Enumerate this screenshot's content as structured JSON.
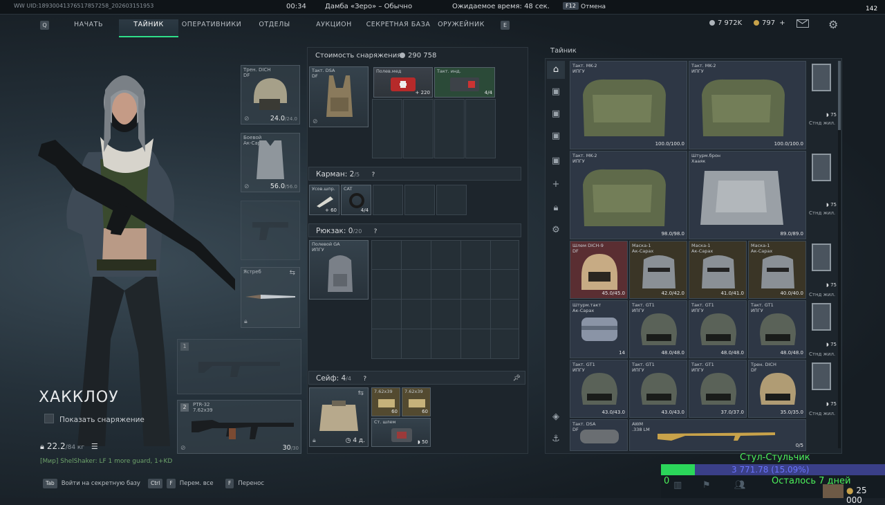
{
  "topbar": {
    "uid": "WW UID:18930041376517857258_202603151953",
    "time": "00:34",
    "map": "Дамба «Зеро» – Обычно",
    "wait": "Ожидаемое время: 48 сек.",
    "cancel_key": "F12",
    "cancel": "Отмена",
    "fps": "142"
  },
  "nav": {
    "left_key": "Q",
    "right_key": "E",
    "tabs": [
      "НАЧАТЬ",
      "ТАЙНИК",
      "ОПЕРАТИВНИКИ",
      "ОТДЕЛЫ",
      "АУКЦИОН",
      "СЕКРЕТНАЯ БАЗА",
      "ОРУЖЕЙНИК"
    ],
    "active": 1
  },
  "currency": {
    "silver": "7 972K",
    "gold": "797"
  },
  "character": {
    "name": "ХАККЛОУ",
    "show_gear": "Показать снаряжение",
    "weight": "22.2",
    "weight_max": "/84 кг",
    "chat": "[Мир] ShelShaker: LF 1 more guard, 1+KD"
  },
  "equip": {
    "helmet": {
      "label1": "Трен. DICH",
      "label2": "DF",
      "dur": "24.0",
      "max": "/24.0"
    },
    "armor": {
      "label1": "Боевой",
      "label2": "Ак-Сарах",
      "dur": "56.0",
      "max": "/56.0"
    },
    "melee": {
      "label1": "Ястреб"
    },
    "slot1_num": "1",
    "slot2_num": "2",
    "weapon2": {
      "label1": "PTR-32",
      "label2": "7.62x39",
      "ammo": "30",
      "ammo_max": "/30"
    }
  },
  "gear": {
    "cost_label": "Стоимость снаряжения",
    "cost": "290 758",
    "vest": {
      "label1": "Такт. DSA",
      "label2": "DF"
    },
    "items_top": [
      {
        "label": "Полев.мед",
        "cnt": "220"
      },
      {
        "label": "Такт. инд.",
        "cnt": "4/4"
      }
    ],
    "pocket_label": "Карман:",
    "pocket_val": "2",
    "pocket_max": "/5",
    "pocket_items": [
      {
        "label": "Усов.шпр.",
        "cnt": "60"
      },
      {
        "label": "CAT",
        "cnt": "4/4"
      }
    ],
    "backpack_label": "Рюкзак:",
    "backpack_val": "0",
    "backpack_max": "/20",
    "backpack": {
      "label1": "Полевой GA",
      "label2": "ИПГУ"
    },
    "safe_label": "Сейф:",
    "safe_val": "4",
    "safe_max": "/4",
    "safe_time": "4 д.",
    "safe_items": [
      {
        "label": "7.62x39",
        "cnt": "60"
      },
      {
        "label": "7.62x39",
        "cnt": "60"
      },
      {
        "label": "Ст. шлем",
        "cnt": "50"
      }
    ],
    "help": "?"
  },
  "stash": {
    "title": "Тайник",
    "items": [
      {
        "l1": "Такт. MK-2",
        "l2": "ИПГУ",
        "dur": "100.0/100.0"
      },
      {
        "l1": "Такт. MK-2",
        "l2": "ИПГУ",
        "dur": "100.0/100.0"
      },
      {
        "l1": "Такт. MK-2",
        "l2": "ИПГУ",
        "dur": "98.0/98.0"
      },
      {
        "l1": "Штурм.брон",
        "l2": "Хааяк",
        "dur": "89.0/89.0"
      },
      {
        "l1": "Шлем DICH-9",
        "l2": "DF",
        "dur": "45.0/45.0"
      },
      {
        "l1": "Маска-1",
        "l2": "Ак-Сарах",
        "dur": "42.0/42.0"
      },
      {
        "l1": "Маска-1",
        "l2": "Ак-Сарах",
        "dur": "41.0/41.0"
      },
      {
        "l1": "Маска-1",
        "l2": "Ак-Сарах",
        "dur": "40.0/40.0"
      },
      {
        "l1": "Штурм.такт",
        "l2": "Ак-Сарах",
        "dur": "14"
      },
      {
        "l1": "Такт. GT1",
        "l2": "ИПГУ",
        "dur": "48.0/48.0"
      },
      {
        "l1": "Такт. GT1",
        "l2": "ИПГУ",
        "dur": "48.0/48.0"
      },
      {
        "l1": "Такт. GT1",
        "l2": "ИПГУ",
        "dur": "48.0/48.0"
      },
      {
        "l1": "Такт. GT1",
        "l2": "ИПГУ",
        "dur": "43.0/43.0"
      },
      {
        "l1": "Такт. GT1",
        "l2": "ИПГУ",
        "dur": "43.0/43.0"
      },
      {
        "l1": "Такт. GT1",
        "l2": "ИПГУ",
        "dur": "37.0/37.0"
      },
      {
        "l1": "Трен. DICH",
        "l2": "DF",
        "dur": "35.0/35.0"
      },
      {
        "l1": "Такт. DSA",
        "l2": "DF",
        "dur": ""
      },
      {
        "l1": "AWM",
        "l2": ".338 LM",
        "dur": "0/5"
      }
    ],
    "side": [
      {
        "label": "Стнд жил.",
        "cnt": "75"
      },
      {
        "label": "Стнд жил.",
        "cnt": "75"
      },
      {
        "label": "Стнд жил.",
        "cnt": "75"
      },
      {
        "label": "Стнд жил.",
        "cnt": "75"
      },
      {
        "label": "Стнд жил.",
        "cnt": "75"
      }
    ]
  },
  "bottom": [
    {
      "key": "Tab",
      "label": "Войти на секретную базу"
    },
    {
      "key": "Ctrl",
      "key2": "F",
      "label": "Перем. все"
    },
    {
      "key": "F",
      "label": "Перенос"
    }
  ],
  "stream": {
    "name": "Стул-Стульчик",
    "progress_text": "3 771.78 (15.09%)",
    "progress": 0.1509,
    "left": "Осталось 7 дней",
    "zero": "0",
    "money": "25 000"
  }
}
